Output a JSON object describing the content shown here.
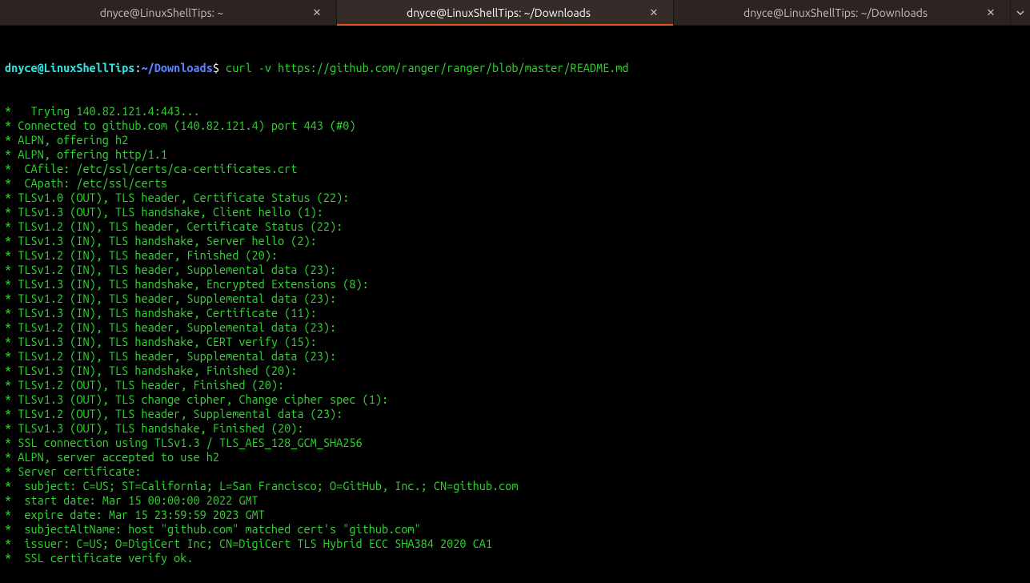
{
  "tabs": [
    {
      "label": "dnyce@LinuxShellTips: ~",
      "active": false
    },
    {
      "label": "dnyce@LinuxShellTips: ~/Downloads",
      "active": true
    },
    {
      "label": "dnyce@LinuxShellTips: ~/Downloads",
      "active": false
    }
  ],
  "prompt": {
    "user": "dnyce@LinuxShellTips",
    "colon": ":",
    "path": "~/Downloads",
    "symbol": "$",
    "command": "curl -v https://github.com/ranger/ranger/blob/master/README.md"
  },
  "output": [
    "*   Trying 140.82.121.4:443...",
    "* Connected to github.com (140.82.121.4) port 443 (#0)",
    "* ALPN, offering h2",
    "* ALPN, offering http/1.1",
    "*  CAfile: /etc/ssl/certs/ca-certificates.crt",
    "*  CApath: /etc/ssl/certs",
    "* TLSv1.0 (OUT), TLS header, Certificate Status (22):",
    "* TLSv1.3 (OUT), TLS handshake, Client hello (1):",
    "* TLSv1.2 (IN), TLS header, Certificate Status (22):",
    "* TLSv1.3 (IN), TLS handshake, Server hello (2):",
    "* TLSv1.2 (IN), TLS header, Finished (20):",
    "* TLSv1.2 (IN), TLS header, Supplemental data (23):",
    "* TLSv1.3 (IN), TLS handshake, Encrypted Extensions (8):",
    "* TLSv1.2 (IN), TLS header, Supplemental data (23):",
    "* TLSv1.3 (IN), TLS handshake, Certificate (11):",
    "* TLSv1.2 (IN), TLS header, Supplemental data (23):",
    "* TLSv1.3 (IN), TLS handshake, CERT verify (15):",
    "* TLSv1.2 (IN), TLS header, Supplemental data (23):",
    "* TLSv1.3 (IN), TLS handshake, Finished (20):",
    "* TLSv1.2 (OUT), TLS header, Finished (20):",
    "* TLSv1.3 (OUT), TLS change cipher, Change cipher spec (1):",
    "* TLSv1.2 (OUT), TLS header, Supplemental data (23):",
    "* TLSv1.3 (OUT), TLS handshake, Finished (20):",
    "* SSL connection using TLSv1.3 / TLS_AES_128_GCM_SHA256",
    "* ALPN, server accepted to use h2",
    "* Server certificate:",
    "*  subject: C=US; ST=California; L=San Francisco; O=GitHub, Inc.; CN=github.com",
    "*  start date: Mar 15 00:00:00 2022 GMT",
    "*  expire date: Mar 15 23:59:59 2023 GMT",
    "*  subjectAltName: host \"github.com\" matched cert's \"github.com\"",
    "*  issuer: C=US; O=DigiCert Inc; CN=DigiCert TLS Hybrid ECC SHA384 2020 CA1",
    "*  SSL certificate verify ok."
  ]
}
